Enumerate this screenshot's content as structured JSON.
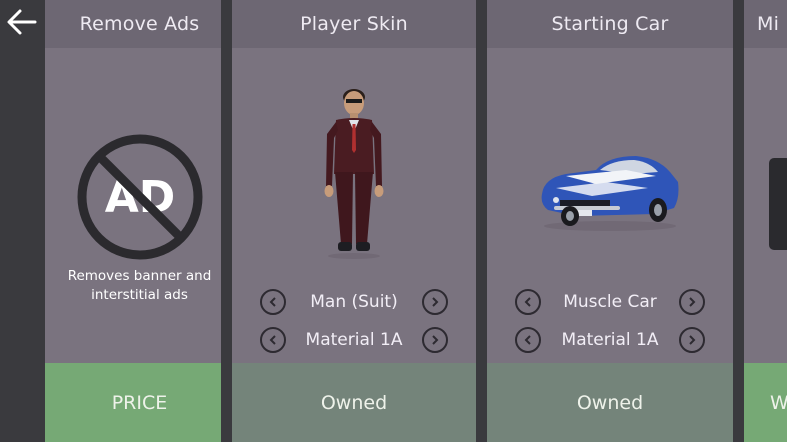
{
  "nav": {
    "back_icon": "arrow-left-icon"
  },
  "cards": [
    {
      "title": "Remove Ads",
      "image_icon": "no-ads-icon",
      "image_text": "AD",
      "description_line1": "Removes banner and",
      "description_line2": "interstitial ads",
      "button": "PRICE"
    },
    {
      "title": "Player Skin",
      "image_icon": "player-man-suit-image",
      "selector1": "Man (Suit)",
      "selector2": "Material 1A",
      "button": "Owned"
    },
    {
      "title": "Starting Car",
      "image_icon": "muscle-car-image",
      "selector1": "Muscle Car",
      "selector2": "Material 1A",
      "button": "Owned"
    },
    {
      "title": "Mi",
      "button": "W"
    }
  ],
  "colors": {
    "background": "#3a3a3e",
    "card": "#7a737f",
    "header": "#6d6773",
    "price_button": "#76a975",
    "owned_button": "#74847a",
    "car_blue": "#2f55b8"
  }
}
